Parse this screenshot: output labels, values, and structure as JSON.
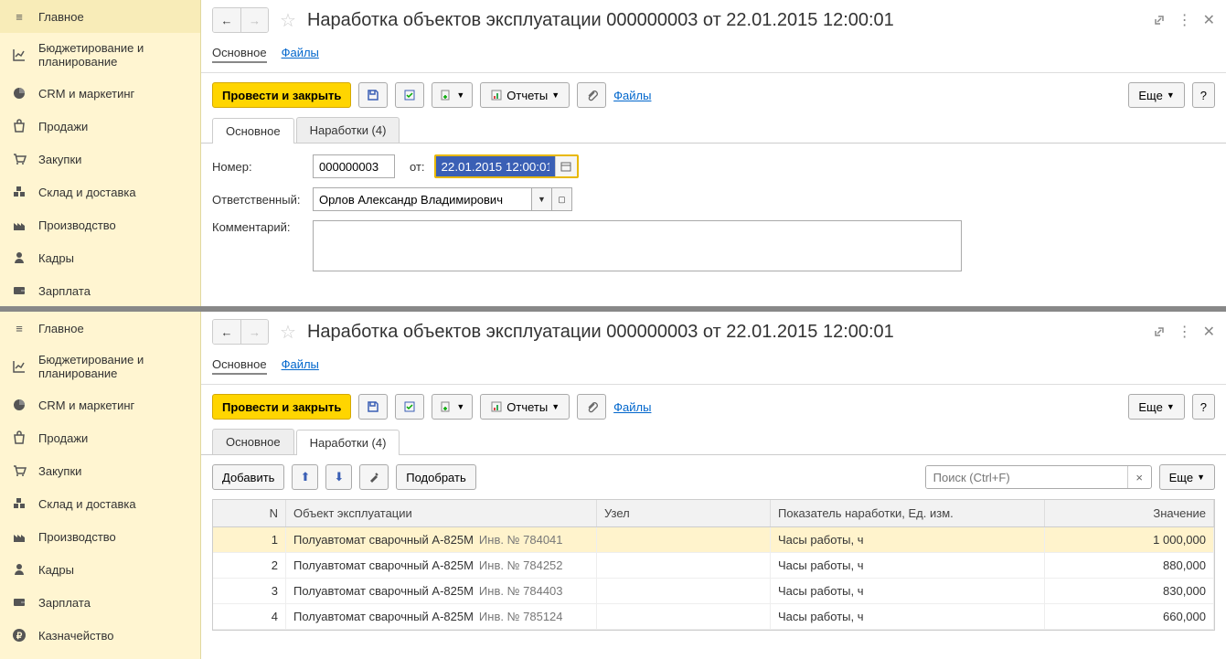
{
  "sidebar": {
    "items": [
      {
        "label": "Главное"
      },
      {
        "label": "Бюджетирование и планирование"
      },
      {
        "label": "CRM и маркетинг"
      },
      {
        "label": "Продажи"
      },
      {
        "label": "Закупки"
      },
      {
        "label": "Склад и доставка"
      },
      {
        "label": "Производство"
      },
      {
        "label": "Кадры"
      },
      {
        "label": "Зарплата"
      }
    ],
    "extra": {
      "label": "Казначейство"
    }
  },
  "header": {
    "title": "Наработка объектов эксплуатации 000000003 от 22.01.2015 12:00:01"
  },
  "subnav": {
    "main": "Основное",
    "files": "Файлы"
  },
  "toolbar": {
    "post_close": "Провести и закрыть",
    "reports": "Отчеты",
    "files": "Файлы",
    "more": "Еще",
    "help": "?"
  },
  "tabs": {
    "main": "Основное",
    "narabotki": "Наработки (4)"
  },
  "form": {
    "label_number": "Номер:",
    "number": "000000003",
    "label_from": "от:",
    "date": "22.01.2015 12:00:01",
    "label_resp": "Ответственный:",
    "resp": "Орлов Александр Владимирович",
    "label_comment": "Комментарий:"
  },
  "table_toolbar": {
    "add": "Добавить",
    "pick": "Подобрать",
    "search_placeholder": "Поиск (Ctrl+F)",
    "more": "Еще"
  },
  "grid": {
    "headers": {
      "n": "N",
      "obj": "Объект эксплуатации",
      "node": "Узел",
      "ind": "Показатель наработки, Ед. изм.",
      "val": "Значение"
    },
    "rows": [
      {
        "n": "1",
        "obj": "Полуавтомат сварочный A-825M",
        "inv": "Инв. № 784041",
        "node": "",
        "ind": "Часы работы, ч",
        "val": "1 000,000"
      },
      {
        "n": "2",
        "obj": "Полуавтомат сварочный A-825M",
        "inv": "Инв. № 784252",
        "node": "",
        "ind": "Часы работы, ч",
        "val": "880,000"
      },
      {
        "n": "3",
        "obj": "Полуавтомат сварочный A-825M",
        "inv": "Инв. № 784403",
        "node": "",
        "ind": "Часы работы, ч",
        "val": "830,000"
      },
      {
        "n": "4",
        "obj": "Полуавтомат сварочный A-825M",
        "inv": "Инв. № 785124",
        "node": "",
        "ind": "Часы работы, ч",
        "val": "660,000"
      }
    ]
  }
}
